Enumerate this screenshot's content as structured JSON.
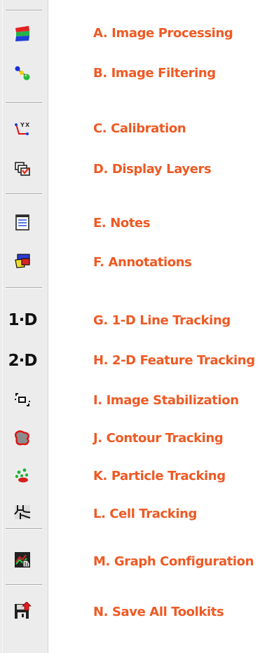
{
  "toolbar": {
    "items": [
      {
        "icon": "image-processing-icon",
        "label": "A. Image Processing"
      },
      {
        "icon": "image-filtering-icon",
        "label": "B. Image Filtering"
      },
      {
        "icon": "calibration-icon",
        "label": "C. Calibration"
      },
      {
        "icon": "display-layers-icon",
        "label": "D. Display Layers"
      },
      {
        "icon": "notes-icon",
        "label": "E. Notes"
      },
      {
        "icon": "annotations-icon",
        "label": "F. Annotations"
      },
      {
        "icon": "1d-line-tracking-icon",
        "icon_text": "1·D",
        "label": "G. 1-D Line Tracking"
      },
      {
        "icon": "2d-feature-tracking-icon",
        "icon_text": "2·D",
        "label": "H. 2-D Feature Tracking"
      },
      {
        "icon": "image-stabilization-icon",
        "label": "I. Image Stabilization"
      },
      {
        "icon": "contour-tracking-icon",
        "label": "J. Contour Tracking"
      },
      {
        "icon": "particle-tracking-icon",
        "label": "K. Particle Tracking"
      },
      {
        "icon": "cell-tracking-icon",
        "label": "L. Cell Tracking"
      },
      {
        "icon": "graph-configuration-icon",
        "label": "M. Graph Configuration"
      },
      {
        "icon": "save-all-toolkits-icon",
        "label": "N. Save All Toolkits"
      }
    ]
  },
  "colors": {
    "label": "#ee5a24",
    "toolbar_bg": "#ececec"
  }
}
